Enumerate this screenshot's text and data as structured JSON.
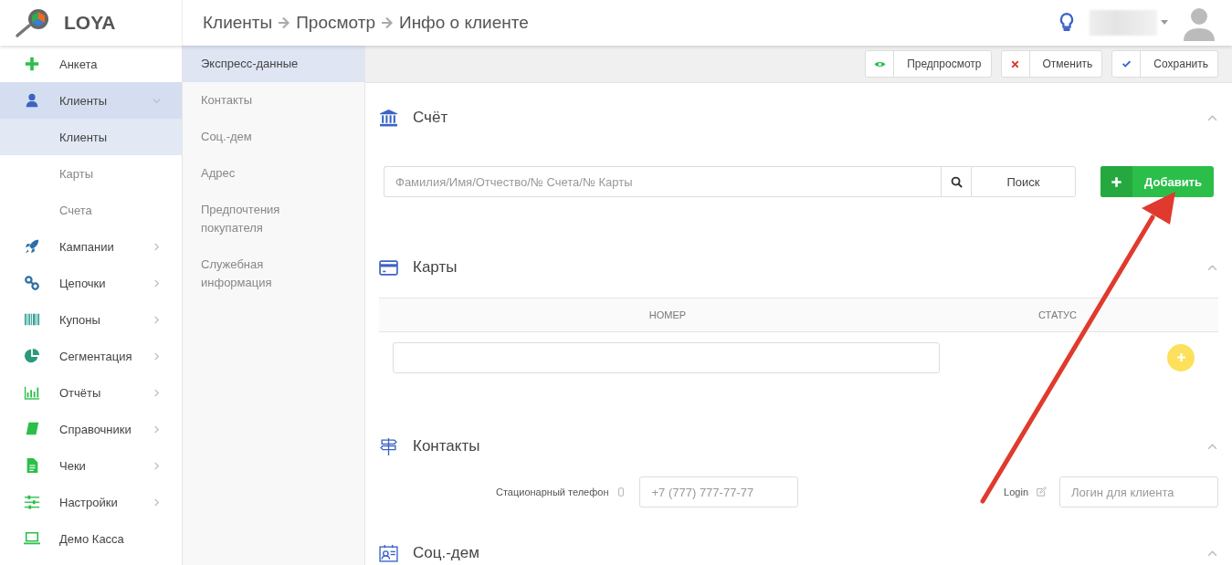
{
  "header": {
    "logo": "LOYA",
    "breadcrumbs": [
      "Клиенты",
      "Просмотр",
      "Инфо о клиенте"
    ]
  },
  "sidebar": {
    "items": [
      {
        "label": "Анкета",
        "kind": "link",
        "selected": false
      },
      {
        "label": "Клиенты",
        "kind": "menu",
        "selected": true,
        "expanded": true,
        "children": [
          {
            "label": "Клиенты",
            "selected": true
          },
          {
            "label": "Карты",
            "selected": false
          },
          {
            "label": "Счета",
            "selected": false
          }
        ]
      },
      {
        "label": "Кампании",
        "kind": "menu",
        "selected": false,
        "expanded": false
      },
      {
        "label": "Цепочки",
        "kind": "menu",
        "selected": false,
        "expanded": false
      },
      {
        "label": "Купоны",
        "kind": "menu",
        "selected": false,
        "expanded": false
      },
      {
        "label": "Сегментация",
        "kind": "menu",
        "selected": false,
        "expanded": false
      },
      {
        "label": "Отчёты",
        "kind": "menu",
        "selected": false,
        "expanded": false
      },
      {
        "label": "Справочники",
        "kind": "menu",
        "selected": false,
        "expanded": false
      },
      {
        "label": "Чеки",
        "kind": "menu",
        "selected": false,
        "expanded": false
      },
      {
        "label": "Настройки",
        "kind": "menu",
        "selected": false,
        "expanded": false
      },
      {
        "label": "Демо Касса",
        "kind": "link",
        "selected": false
      }
    ]
  },
  "subnav": {
    "items": [
      {
        "label": "Экспресс-данные",
        "selected": true
      },
      {
        "label": "Контакты",
        "selected": false
      },
      {
        "label": "Соц.-дем",
        "selected": false
      },
      {
        "label": "Адрес",
        "selected": false
      },
      {
        "label": "Предпочтения покупателя",
        "selected": false
      },
      {
        "label": "Служебная информация",
        "selected": false
      }
    ]
  },
  "toolbar": {
    "buttons": [
      "Предпросмотр",
      "Отменить",
      "Сохранить"
    ]
  },
  "sections": [
    {
      "kind": "account",
      "title": "Счёт",
      "expanded": true,
      "search": {
        "placeholder": "Фамилия/Имя/Отчество/№ Счета/№ Карты"
      },
      "search_button": "Поиск",
      "add_button": "Добавить"
    },
    {
      "kind": "cards",
      "title": "Карты",
      "expanded": true,
      "table": {
        "columns": [
          "НОМЕР",
          "СТАТУС"
        ]
      }
    },
    {
      "kind": "contacts",
      "title": "Контакты",
      "expanded": true,
      "fields": [
        {
          "label": "Стационарный телефон",
          "placeholder": "+7 (777) 777-77-77"
        },
        {
          "label": "Login",
          "placeholder": "Логин для клиента"
        }
      ]
    },
    {
      "kind": "socdem",
      "title": "Соц.-дем",
      "expanded": true
    }
  ]
}
